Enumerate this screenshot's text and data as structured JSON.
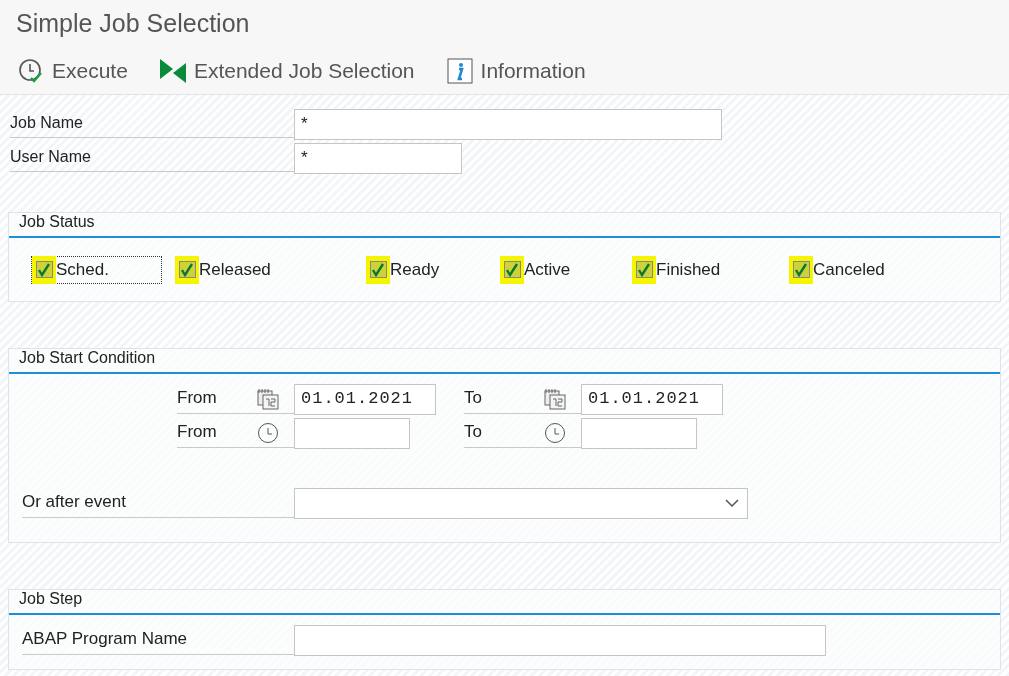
{
  "window": {
    "title": "Simple Job Selection"
  },
  "toolbar": [
    {
      "kind": "execute",
      "label": "Execute"
    },
    {
      "kind": "extended",
      "label": "Extended Job Selection"
    },
    {
      "kind": "info",
      "label": "Information"
    }
  ],
  "fields": [
    {
      "label": "Job Name",
      "value": "*"
    },
    {
      "label": "User Name",
      "value": "*"
    }
  ],
  "job_status": {
    "title": "Job Status",
    "items": [
      {
        "label": "Sched.",
        "checked": true,
        "focused": true
      },
      {
        "label": "Released",
        "checked": true,
        "focused": false
      },
      {
        "label": "Ready",
        "checked": true,
        "focused": false
      },
      {
        "label": "Active",
        "checked": true,
        "focused": false
      },
      {
        "label": "Finished",
        "checked": true,
        "focused": false
      },
      {
        "label": "Canceled",
        "checked": true,
        "focused": false
      }
    ]
  },
  "job_start_condition": {
    "title": "Job Start Condition",
    "rows": [
      {
        "kind": "date",
        "from_label": "From",
        "from_value": "01.01.2021",
        "to_label": "To",
        "to_value": "01.01.2021"
      },
      {
        "kind": "time",
        "from_label": "From",
        "to_label": "To"
      }
    ],
    "event_label": "Or after event"
  },
  "job_step": {
    "title": "Job Step",
    "program_label": "ABAP Program Name"
  }
}
